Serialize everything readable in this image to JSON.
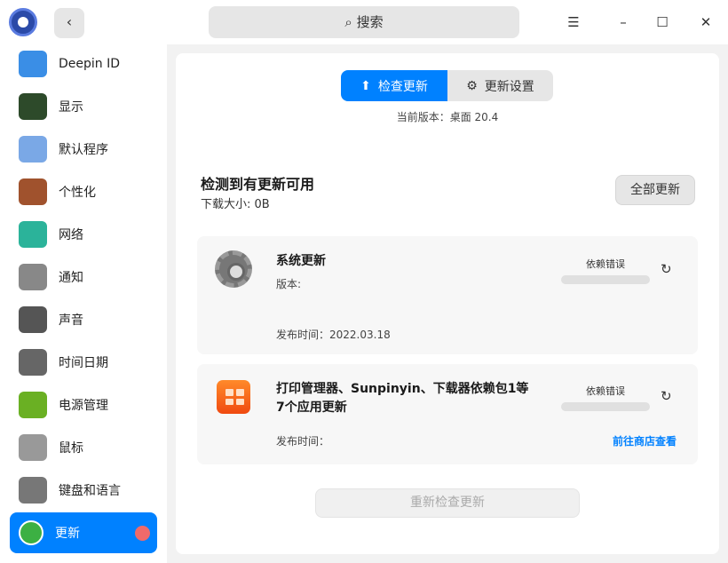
{
  "titlebar": {
    "search_placeholder": "搜索",
    "back_label": "‹",
    "menu_icon": "☰",
    "min_icon": "–",
    "max_icon": "☐",
    "close_icon": "✕"
  },
  "sidebar": {
    "items": [
      {
        "label": "Deepin ID",
        "color": "#3a8ee6"
      },
      {
        "label": "显示",
        "color": "#2d4a2a"
      },
      {
        "label": "默认程序",
        "color": "#7aa8e6"
      },
      {
        "label": "个性化",
        "color": "#a0522d"
      },
      {
        "label": "网络",
        "color": "#2bb39a"
      },
      {
        "label": "通知",
        "color": "#888888"
      },
      {
        "label": "声音",
        "color": "#555555"
      },
      {
        "label": "时间日期",
        "color": "#666666"
      },
      {
        "label": "电源管理",
        "color": "#6ab023"
      },
      {
        "label": "鼠标",
        "color": "#999999"
      },
      {
        "label": "键盘和语言",
        "color": "#777777"
      },
      {
        "label": "更新",
        "color": "#3cb043"
      }
    ]
  },
  "main": {
    "tabs": [
      {
        "label": "检查更新",
        "icon": "⬆"
      },
      {
        "label": "更新设置",
        "icon": "⚙"
      }
    ],
    "current_version": "当前版本：桌面 20.4",
    "heading": "检测到有更新可用",
    "download_size": "下载大小: 0B",
    "update_all": "全部更新",
    "cards": [
      {
        "title": "系统更新",
        "version": "版本:",
        "status": "依赖错误",
        "release": "发布时间：2022.03.18"
      },
      {
        "title": "打印管理器、Sunpinyin、下载器依赖包1等",
        "title2": "7个应用更新",
        "status": "依赖错误",
        "release": "发布时间：",
        "link": "前往商店查看"
      }
    ],
    "recheck": "重新检查更新"
  }
}
